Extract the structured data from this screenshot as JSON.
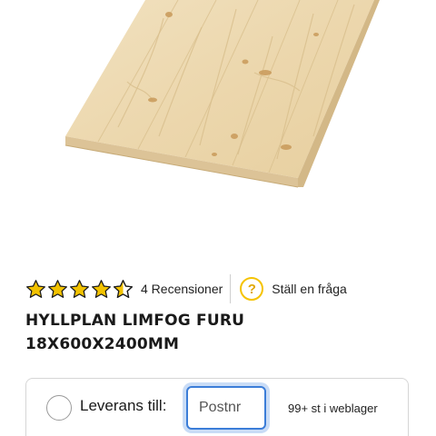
{
  "product": {
    "rating": 4.5,
    "reviews_label": "4 Recensioner",
    "ask_label": "Ställ en fråga",
    "title_line1": "HYLLPLAN LIMFOG FURU",
    "title_line2": "18X600X2400MM"
  },
  "delivery": {
    "label": "Leverans till:",
    "postal_placeholder": "Postnr",
    "stock_text": "99+ st i weblager"
  },
  "colors": {
    "star": "#f2c200",
    "accent_blue": "#3b7dd8",
    "question_icon": "#f5c300"
  },
  "icons": [
    "star-icon",
    "question-icon",
    "radio-icon"
  ]
}
